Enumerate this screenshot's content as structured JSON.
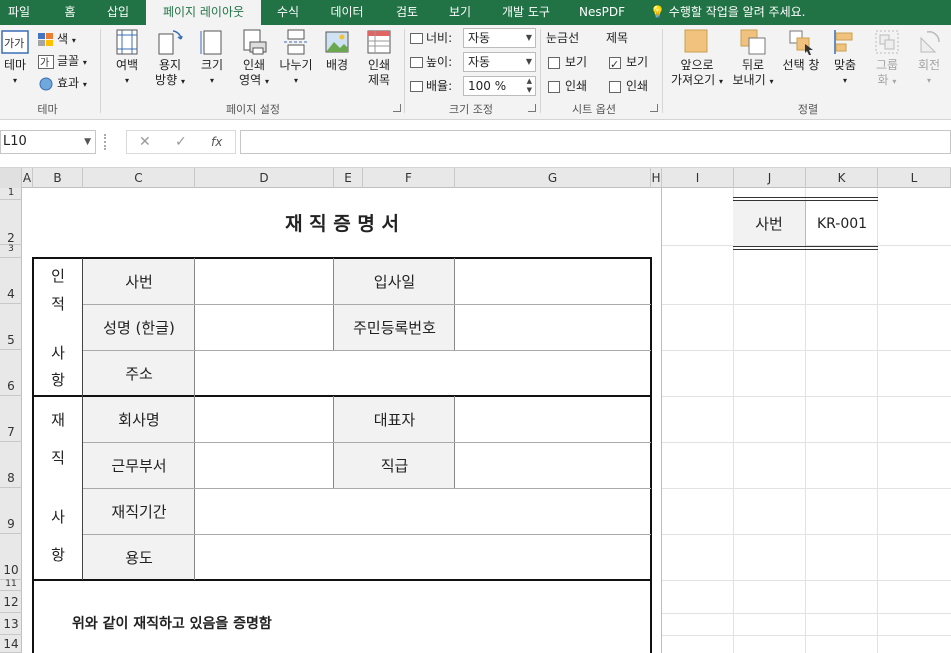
{
  "tabs": [
    "파일",
    "홈",
    "삽입",
    "페이지 레이아웃",
    "수식",
    "데이터",
    "검토",
    "보기",
    "개발 도구",
    "NesPDF"
  ],
  "tell_me": "수행할 작업을 알려 주세요.",
  "ribbon": {
    "theme": {
      "theme_label": "테마",
      "color_label": "색",
      "font_label": "글꼴",
      "effect_label": "효과",
      "group_label": "테마"
    },
    "page_setup": {
      "margins": "여백",
      "orientation_1": "용지",
      "orientation_2": "방향",
      "size": "크기",
      "print_area_1": "인쇄",
      "print_area_2": "영역",
      "breaks": "나누기",
      "background": "배경",
      "print_titles_1": "인쇄",
      "print_titles_2": "제목",
      "group_label": "페이지 설정"
    },
    "scale": {
      "width_label": "너비:",
      "width_value": "자동",
      "height_label": "높이:",
      "height_value": "자동",
      "scale_label": "배율:",
      "scale_value": "100 %",
      "group_label": "크기 조정"
    },
    "sheet_options": {
      "gridlines": "눈금선",
      "headings": "제목",
      "view": "보기",
      "print": "인쇄",
      "gridlines_view": false,
      "gridlines_print": false,
      "headings_view": true,
      "headings_print": false,
      "group_label": "시트 옵션"
    },
    "arrange": {
      "bring_forward_1": "앞으로",
      "bring_forward_2": "가져오기",
      "send_backward_1": "뒤로",
      "send_backward_2": "보내기",
      "selection_pane": "선택 창",
      "align": "맞춤",
      "group_1": "그룹",
      "group_2": "화",
      "rotate": "회전",
      "group_label": "정렬"
    }
  },
  "formula_bar": {
    "name_box": "L10",
    "fx": "fx",
    "formula": ""
  },
  "columns": [
    "A",
    "B",
    "C",
    "D",
    "E",
    "F",
    "G",
    "H",
    "I",
    "J",
    "K",
    "L"
  ],
  "rows": [
    "1",
    "2",
    "3",
    "4",
    "5",
    "6",
    "7",
    "8",
    "9",
    "10",
    "11",
    "12",
    "13",
    "14"
  ],
  "doc": {
    "title": "재 직 증 명 서",
    "personal_chars": [
      "인",
      "적",
      "사",
      "항"
    ],
    "employment_chars": [
      "재",
      "직",
      "사",
      "항"
    ],
    "employee_no": "사번",
    "hire_date": "입사일",
    "name_kr": "성명 (한글)",
    "resident_no": "주민등록번호",
    "address": "주소",
    "company": "회사명",
    "ceo": "대표자",
    "department": "근무부서",
    "position": "직급",
    "period": "재직기간",
    "purpose": "용도",
    "statement": "위와 같이 재직하고 있음을 증명함"
  },
  "side": {
    "label": "사번",
    "value": "KR-001"
  }
}
